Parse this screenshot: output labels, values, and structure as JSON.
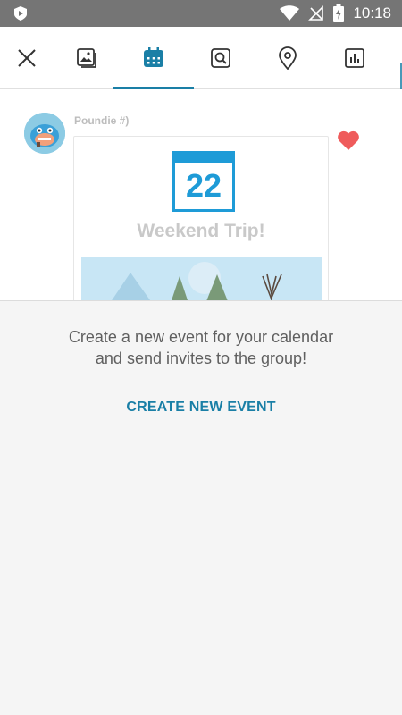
{
  "status_bar": {
    "time": "10:18",
    "icons": [
      "app-badge-icon",
      "wifi-icon",
      "no-signal-icon",
      "battery-charging-icon"
    ]
  },
  "toolbar": {
    "items": [
      {
        "name": "close-icon",
        "active": false
      },
      {
        "name": "photo-icon",
        "active": false
      },
      {
        "name": "calendar-icon",
        "active": true
      },
      {
        "name": "search-icon",
        "active": false
      },
      {
        "name": "location-pin-icon",
        "active": false
      },
      {
        "name": "poll-icon",
        "active": false
      }
    ],
    "accent_color": "#1a7fa6"
  },
  "post": {
    "author": "Poundie #)",
    "liked": true,
    "heart_color": "#ef5b5b",
    "card": {
      "calendar_day": "22",
      "title": "Weekend Trip!"
    }
  },
  "sheet": {
    "description": "Create a new event for your calendar\nand send invites to the group!",
    "create_label": "CREATE NEW EVENT"
  }
}
